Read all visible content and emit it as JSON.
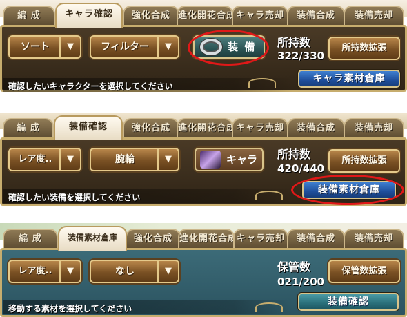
{
  "panel1": {
    "tabs": [
      "編 成",
      "キャラ確認",
      "強化合成",
      "進化開花合成",
      "キャラ売却",
      "装備合成",
      "装備売却"
    ],
    "sort_label": "ソート",
    "filter_label": "フィルター",
    "arrow": "▼",
    "equip_button": "装 備",
    "count_label": "所持数",
    "count_value": "322/330",
    "expand_button": "所持数拡張",
    "storage_button": "キャラ素材倉庫",
    "instruction": "確認したいキャラクターを選択してください"
  },
  "panel2": {
    "tabs": [
      "編 成",
      "装備確認",
      "強化合成",
      "進化開花合成",
      "キャラ売却",
      "装備合成",
      "装備売却"
    ],
    "rarity_label": "レア度..",
    "category_label": "腕輪",
    "arrow": "▼",
    "chara_button": "キャラ",
    "count_label": "所持数",
    "count_value": "420/440",
    "expand_button": "所持数拡張",
    "storage_button": "装備素材倉庫",
    "instruction": "確認したい装備を選択してください"
  },
  "panel3": {
    "tabs": [
      "編 成",
      "装備素材倉庫",
      "強化合成",
      "進化開花合成",
      "キャラ売却",
      "装備合成",
      "装備売却"
    ],
    "rarity_label": "レア度..",
    "category_label": "なし",
    "arrow": "▼",
    "count_label": "保管数",
    "count_value": "021/200",
    "expand_button": "保管数拡張",
    "confirm_button": "装備確認",
    "instruction": "移動する素材を選択してください"
  },
  "colors": {
    "highlight": "#e01818",
    "frame_gold": "#c7ad6e",
    "blue_button": "#1f4f9c",
    "teal_panel": "#2b5360"
  }
}
